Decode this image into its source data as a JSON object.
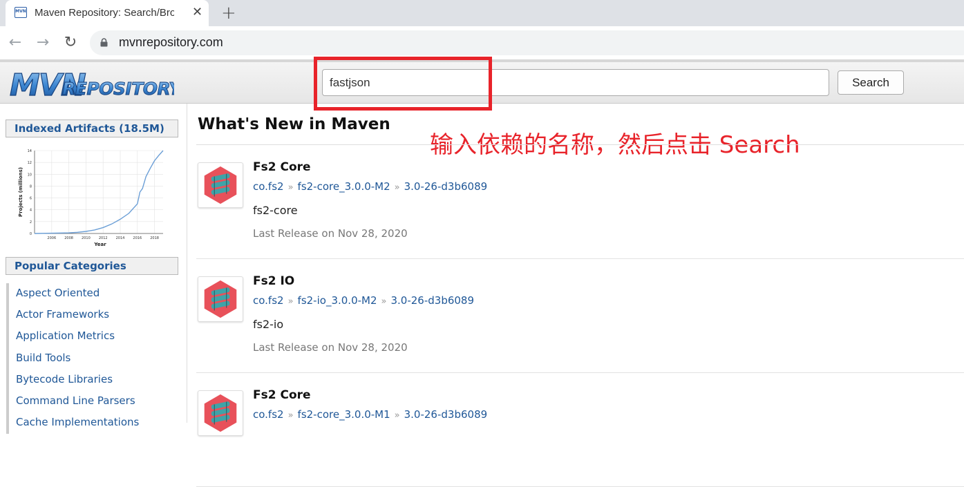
{
  "browser": {
    "tab_title": "Maven Repository: Search/Browse/Explore",
    "favicon_text": "MVN",
    "url": "mvnrepository.com"
  },
  "header": {
    "logo_text": "MVNREPOSITORY",
    "search_value": "fastjson",
    "search_button": "Search"
  },
  "sidebar": {
    "indexed_artifacts": "Indexed Artifacts (18.5M)",
    "popular_categories": "Popular Categories",
    "chart_ylabel": "Projects (millions)",
    "chart_xlabel": "Year",
    "categories": [
      "Aspect Oriented",
      "Actor Frameworks",
      "Application Metrics",
      "Build Tools",
      "Bytecode Libraries",
      "Command Line Parsers",
      "Cache Implementations"
    ]
  },
  "main": {
    "title": "What's New in Maven",
    "annotation": "输入依赖的名称，然后点击 Search",
    "artifacts": [
      {
        "name": "Fs2 Core",
        "group": "co.fs2",
        "artifact": "fs2-core_3.0.0-M2",
        "version": "3.0-26-d3b6089",
        "description": "fs2-core",
        "release": "Last Release on Nov 28, 2020"
      },
      {
        "name": "Fs2 IO",
        "group": "co.fs2",
        "artifact": "fs2-io_3.0.0-M2",
        "version": "3.0-26-d3b6089",
        "description": "fs2-io",
        "release": "Last Release on Nov 28, 2020"
      },
      {
        "name": "Fs2 Core",
        "group": "co.fs2",
        "artifact": "fs2-core_3.0.0-M1",
        "version": "3.0-26-d3b6089",
        "description": "",
        "release": ""
      }
    ]
  },
  "chart_data": {
    "type": "line",
    "xlabel": "Year",
    "ylabel": "Projects (millions)",
    "xlim": [
      2004,
      2019
    ],
    "ylim": [
      0,
      14
    ],
    "x_ticks": [
      "2006",
      "2008",
      "2010",
      "2012",
      "2014",
      "2016",
      "2018"
    ],
    "y_ticks": [
      "0",
      "2",
      "4",
      "6",
      "8",
      "10",
      "12",
      "14"
    ],
    "grid": true,
    "series": [
      {
        "x": [
          2004,
          2006,
          2008,
          2009,
          2010,
          2011,
          2012,
          2013,
          2014,
          2015,
          2016,
          2016.3,
          2016.6,
          2017,
          2017.5,
          2018,
          2018.5,
          2019
        ],
        "values": [
          0,
          0.05,
          0.1,
          0.2,
          0.35,
          0.6,
          1.0,
          1.6,
          2.4,
          3.4,
          5.0,
          7.0,
          7.6,
          9.6,
          11.0,
          12.3,
          13.2,
          14.0
        ]
      }
    ],
    "color": "#6a9ed6"
  },
  "colors": {
    "link": "#1f5797",
    "annotation": "#e8232a",
    "icon_bg": "#e8515a",
    "icon_fg": "#3fa3a8"
  }
}
